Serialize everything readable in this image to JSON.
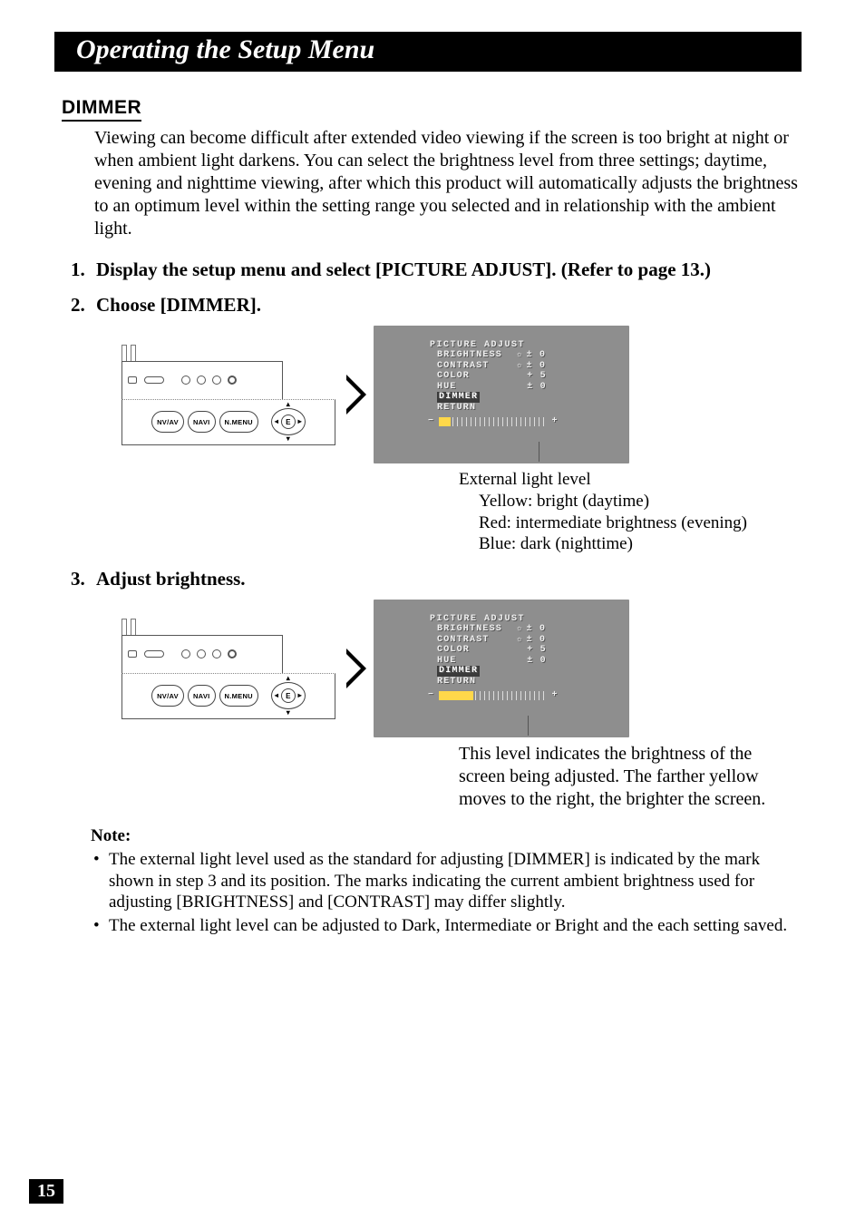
{
  "page": {
    "title_bar": "Operating the Setup Menu",
    "section_heading": "DIMMER",
    "page_number": "15",
    "intro": "Viewing can become difficult after extended video viewing if the screen is too bright at night or when ambient light darkens. You can select the brightness level from three settings; daytime, evening and nighttime viewing, after which this product will automatically adjusts the brightness to an optimum level within the setting range you selected and in relationship with the ambient light."
  },
  "steps": {
    "s1": "Display the setup menu and select [PICTURE ADJUST]. (Refer to page 13.)",
    "s2": "Choose [DIMMER].",
    "s3": "Adjust brightness."
  },
  "buttons": {
    "nv_av": "NV/AV",
    "navi": "NAVI",
    "nmenu": "N.MENU",
    "e": "E"
  },
  "osd": {
    "title": "PICTURE ADJUST",
    "rows": [
      {
        "label": "BRIGHTNESS",
        "val": "± 0"
      },
      {
        "label": "CONTRAST",
        "val": "± 0"
      },
      {
        "label": "COLOR",
        "val": "+ 5"
      },
      {
        "label": "HUE",
        "val": "± 0"
      }
    ],
    "dimmer": "DIMMER",
    "return": "RETURN",
    "minus": "−",
    "plus": "+"
  },
  "captions": {
    "ext_title": "External light level",
    "ext_yellow": "Yellow: bright (daytime)",
    "ext_red": "Red: intermediate brightness (evening)",
    "ext_blue": "Blue: dark (nighttime)",
    "adjust": "This level indicates the brightness of the screen being adjusted. The farther yellow moves to the right, the brighter the screen."
  },
  "note": {
    "heading": "Note:",
    "items": [
      "The external light level used as the standard for adjusting [DIMMER] is indicated by the mark shown in step 3 and its position. The marks indicating the current ambient brightness used for adjusting [BRIGHTNESS] and [CONTRAST] may differ slightly.",
      "The external light level can be adjusted to Dark, Intermediate or Bright and the each setting saved."
    ]
  }
}
